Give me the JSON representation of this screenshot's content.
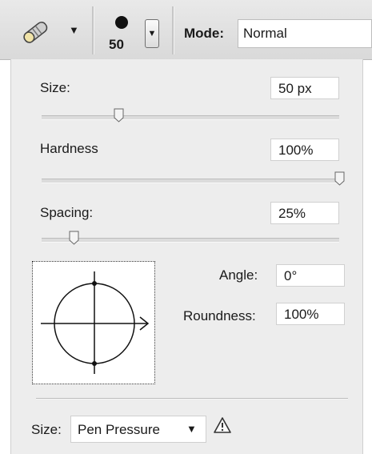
{
  "options_bar": {
    "tool_icon": "brush-tool-icon",
    "brush_size": "50",
    "mode_label": "Mode:",
    "mode_value": "Normal"
  },
  "brush_panel": {
    "size": {
      "label": "Size:",
      "value": "50 px",
      "slider_fraction": 0.26
    },
    "hardness": {
      "label": "Hardness",
      "value": "100%",
      "slider_fraction": 1.0
    },
    "spacing": {
      "label": "Spacing:",
      "value": "25%",
      "slider_fraction": 0.11
    },
    "angle": {
      "label": "Angle:",
      "value": "0°"
    },
    "roundness": {
      "label": "Roundness:",
      "value": "100%"
    },
    "dynamics": {
      "label": "Size:",
      "value": "Pen Pressure",
      "icon": "warning-triangle-icon"
    }
  }
}
